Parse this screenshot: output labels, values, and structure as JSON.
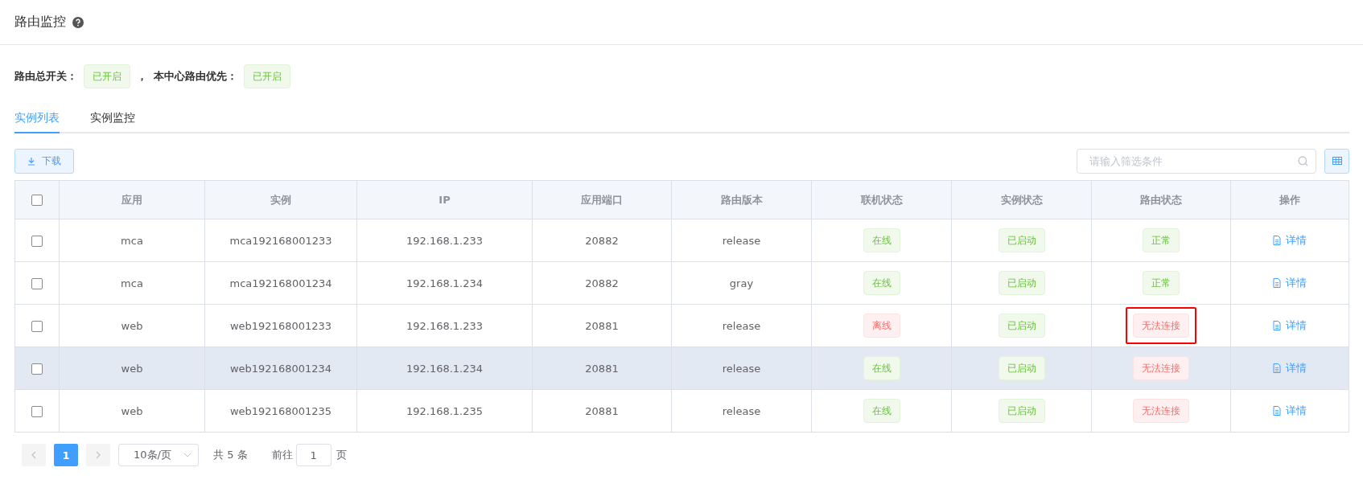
{
  "page": {
    "title": "路由监控"
  },
  "switches": [
    {
      "label": "路由总开关：",
      "value": "已开启",
      "kind": "success"
    },
    {
      "label": "本中心路由优先：",
      "value": "已开启",
      "kind": "success"
    }
  ],
  "separator": "，",
  "tabs": [
    {
      "label": "实例列表",
      "selected": true
    },
    {
      "label": "实例监控",
      "selected": false
    }
  ],
  "toolbar": {
    "download": "下载",
    "search": {
      "placeholder": "请输入筛选条件"
    }
  },
  "table": {
    "select_all": {
      "checked": false
    },
    "columns": [
      "应用",
      "实例",
      "IP",
      "应用端口",
      "路由版本",
      "联机状态",
      "实例状态",
      "路由状态",
      "操作"
    ],
    "rows": [
      {
        "checked": false,
        "hovered": false,
        "app": "mca",
        "instance": "mca192168001233",
        "ip": "192.168.1.233",
        "port": "20882",
        "version": "release",
        "online": {
          "text": "在线",
          "kind": "success"
        },
        "instance_status": {
          "text": "已启动",
          "kind": "success"
        },
        "route_status": {
          "text": "正常",
          "kind": "success",
          "annotated": false
        },
        "action": "详情"
      },
      {
        "checked": false,
        "hovered": false,
        "app": "mca",
        "instance": "mca192168001234",
        "ip": "192.168.1.234",
        "port": "20882",
        "version": "gray",
        "online": {
          "text": "在线",
          "kind": "success"
        },
        "instance_status": {
          "text": "已启动",
          "kind": "success"
        },
        "route_status": {
          "text": "正常",
          "kind": "success",
          "annotated": false
        },
        "action": "详情"
      },
      {
        "checked": false,
        "hovered": false,
        "app": "web",
        "instance": "web192168001233",
        "ip": "192.168.1.233",
        "port": "20881",
        "version": "release",
        "online": {
          "text": "离线",
          "kind": "danger"
        },
        "instance_status": {
          "text": "已启动",
          "kind": "success"
        },
        "route_status": {
          "text": "无法连接",
          "kind": "danger",
          "annotated": true
        },
        "action": "详情"
      },
      {
        "checked": false,
        "hovered": true,
        "app": "web",
        "instance": "web192168001234",
        "ip": "192.168.1.234",
        "port": "20881",
        "version": "release",
        "online": {
          "text": "在线",
          "kind": "success"
        },
        "instance_status": {
          "text": "已启动",
          "kind": "success"
        },
        "route_status": {
          "text": "无法连接",
          "kind": "danger",
          "annotated": false
        },
        "action": "详情"
      },
      {
        "checked": false,
        "hovered": false,
        "app": "web",
        "instance": "web192168001235",
        "ip": "192.168.1.235",
        "port": "20881",
        "version": "release",
        "online": {
          "text": "在线",
          "kind": "success"
        },
        "instance_status": {
          "text": "已启动",
          "kind": "success"
        },
        "route_status": {
          "text": "无法连接",
          "kind": "danger",
          "annotated": false
        },
        "action": "详情"
      }
    ]
  },
  "pagination": {
    "pages": [
      {
        "label": "1",
        "selected": true
      }
    ],
    "page_size": "10条/页",
    "total": "共 5 条",
    "goto_label": "前往",
    "goto_value": "1",
    "goto_suffix": "页"
  }
}
